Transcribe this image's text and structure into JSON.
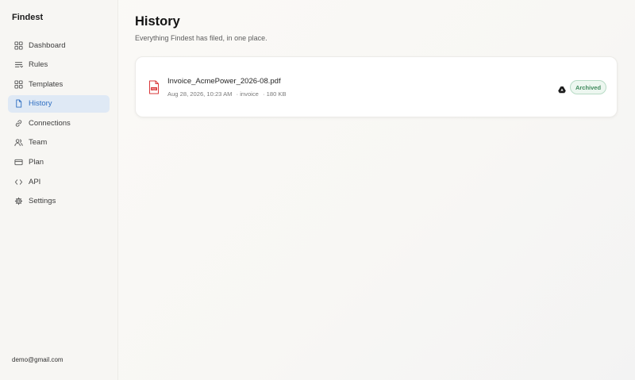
{
  "app": {
    "name": "Findest"
  },
  "sidebar": {
    "items": [
      {
        "label": "Dashboard",
        "icon": "grid-icon"
      },
      {
        "label": "Rules",
        "icon": "filter-lines-icon"
      },
      {
        "label": "Templates",
        "icon": "grid-icon"
      },
      {
        "label": "History",
        "icon": "document-icon",
        "active": true
      },
      {
        "label": "Connections",
        "icon": "link-icon"
      },
      {
        "label": "Team",
        "icon": "users-icon"
      },
      {
        "label": "Plan",
        "icon": "credit-card-icon"
      },
      {
        "label": "API",
        "icon": "code-icon"
      },
      {
        "label": "Settings",
        "icon": "gear-icon"
      }
    ],
    "user_email": "demo@gmail.com"
  },
  "page": {
    "title": "History",
    "subtitle": "Everything Findest has filed, in one place."
  },
  "history": [
    {
      "file_name": "Invoice_AcmePower_2026-08.pdf",
      "date": "Aug 28, 2026, 10:23 AM",
      "type": "· invoice",
      "size": "· 180 KB",
      "status": "Archived",
      "file_icon": "pdf-file-icon",
      "destination_icon": "google-drive-icon"
    }
  ],
  "colors": {
    "accent": "#2f6fc2",
    "active_bg": "#dfe9f5",
    "status_archived": "#3f8a5c",
    "pdf_red": "#d9383a"
  }
}
